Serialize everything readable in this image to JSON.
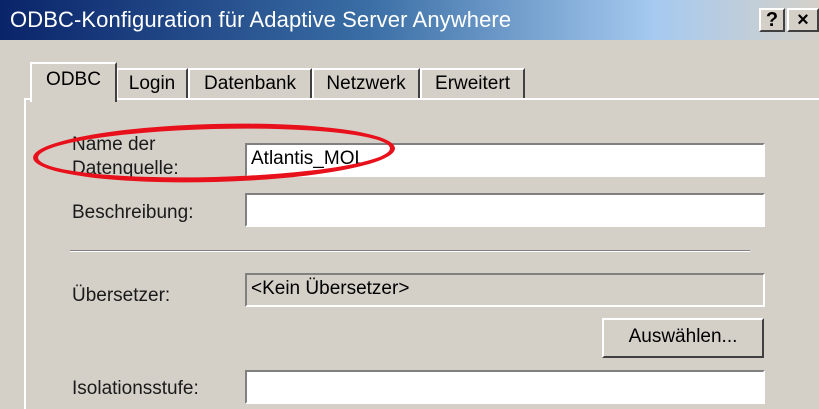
{
  "window": {
    "title": "ODBC-Konfiguration für Adaptive Server Anywhere",
    "help_button": "?",
    "close_button": "×"
  },
  "tabs": [
    {
      "label": "ODBC",
      "active": true
    },
    {
      "label": "Login",
      "active": false
    },
    {
      "label": "Datenbank",
      "active": false
    },
    {
      "label": "Netzwerk",
      "active": false
    },
    {
      "label": "Erweitert",
      "active": false
    }
  ],
  "form": {
    "datasource_label_line1": "Name der",
    "datasource_label_line2": "Datenquelle:",
    "datasource_value": "Atlantis_MOL",
    "description_label": "Beschreibung:",
    "description_value": "",
    "translator_label": "Übersetzer:",
    "translator_value": "<Kein Übersetzer>",
    "select_button": "Auswählen...",
    "isolation_label": "Isolationsstufe:",
    "isolation_value": ""
  },
  "colors": {
    "highlight": "#e8101a",
    "title_bar": "#0a246a",
    "dialog_face": "#d4d0c8"
  }
}
